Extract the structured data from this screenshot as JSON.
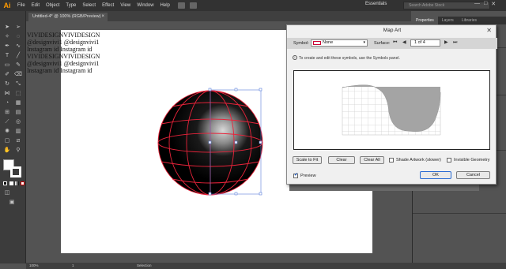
{
  "app": {
    "logo": "Ai",
    "menu": [
      "File",
      "Edit",
      "Object",
      "Type",
      "Select",
      "Effect",
      "View",
      "Window",
      "Help"
    ],
    "workspace": "Essentials",
    "search_placeholder": "Search Adobe Stock",
    "window_controls": [
      "—",
      "□",
      "✕"
    ]
  },
  "document_tab": {
    "title": "Untitled-4* @ 100% (RGB/Preview)",
    "close": "×"
  },
  "watermark": {
    "lines": [
      "VIVIDESIGNVIVIDESIGN",
      "@designvivi1 @designvivi1",
      "Instagram id  Instagram id",
      "VIVIDESIGNVIVIDESIGN",
      "@designvivi1 @designvivi1",
      "Instagram id  Instagram id"
    ]
  },
  "right_panel": {
    "tabs": [
      "Properties",
      "Layers",
      "Libraries"
    ]
  },
  "dialog": {
    "title": "Map Art",
    "close": "✕",
    "symbol_label": "Symbol:",
    "symbol_value": "None",
    "surface_label": "Surface:",
    "surface_value": "1 of 4",
    "info_text": "To create and edit these symbols, use the Symbols panel.",
    "buttons": {
      "scale_to_fit": "Scale to Fit",
      "clear": "Clear",
      "clear_all": "Clear All",
      "ok": "OK",
      "cancel": "Cancel"
    },
    "shade_artwork_label": "Shade Artwork (slower)",
    "invisible_geometry_label": "Invisible Geometry",
    "preview_label": "Preview",
    "preview_checked": true,
    "shade_checked": false,
    "invisible_checked": false
  },
  "status": {
    "zoom": "100%",
    "page": "1",
    "tool": "Selection"
  },
  "colors": {
    "sphere_wire": "#e8233a",
    "surface_fill": "#a4a4a4",
    "accent": "#ff9a00"
  }
}
